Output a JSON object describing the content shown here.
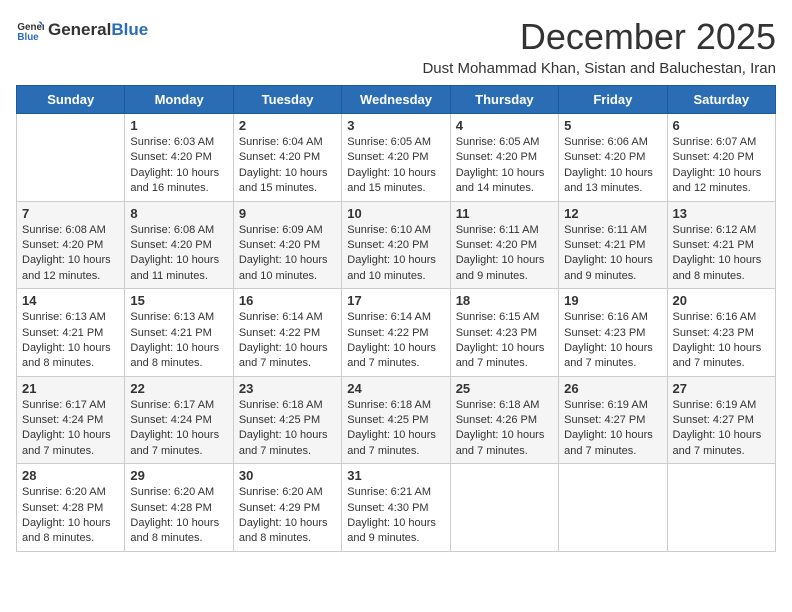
{
  "logo": {
    "general": "General",
    "blue": "Blue"
  },
  "title": "December 2025",
  "subtitle": "Dust Mohammad Khan, Sistan and Baluchestan, Iran",
  "weekdays": [
    "Sunday",
    "Monday",
    "Tuesday",
    "Wednesday",
    "Thursday",
    "Friday",
    "Saturday"
  ],
  "weeks": [
    [
      {
        "day": "",
        "content": ""
      },
      {
        "day": "1",
        "content": "Sunrise: 6:03 AM\nSunset: 4:20 PM\nDaylight: 10 hours\nand 16 minutes."
      },
      {
        "day": "2",
        "content": "Sunrise: 6:04 AM\nSunset: 4:20 PM\nDaylight: 10 hours\nand 15 minutes."
      },
      {
        "day": "3",
        "content": "Sunrise: 6:05 AM\nSunset: 4:20 PM\nDaylight: 10 hours\nand 15 minutes."
      },
      {
        "day": "4",
        "content": "Sunrise: 6:05 AM\nSunset: 4:20 PM\nDaylight: 10 hours\nand 14 minutes."
      },
      {
        "day": "5",
        "content": "Sunrise: 6:06 AM\nSunset: 4:20 PM\nDaylight: 10 hours\nand 13 minutes."
      },
      {
        "day": "6",
        "content": "Sunrise: 6:07 AM\nSunset: 4:20 PM\nDaylight: 10 hours\nand 12 minutes."
      }
    ],
    [
      {
        "day": "7",
        "content": "Sunrise: 6:08 AM\nSunset: 4:20 PM\nDaylight: 10 hours\nand 12 minutes."
      },
      {
        "day": "8",
        "content": "Sunrise: 6:08 AM\nSunset: 4:20 PM\nDaylight: 10 hours\nand 11 minutes."
      },
      {
        "day": "9",
        "content": "Sunrise: 6:09 AM\nSunset: 4:20 PM\nDaylight: 10 hours\nand 10 minutes."
      },
      {
        "day": "10",
        "content": "Sunrise: 6:10 AM\nSunset: 4:20 PM\nDaylight: 10 hours\nand 10 minutes."
      },
      {
        "day": "11",
        "content": "Sunrise: 6:11 AM\nSunset: 4:20 PM\nDaylight: 10 hours\nand 9 minutes."
      },
      {
        "day": "12",
        "content": "Sunrise: 6:11 AM\nSunset: 4:21 PM\nDaylight: 10 hours\nand 9 minutes."
      },
      {
        "day": "13",
        "content": "Sunrise: 6:12 AM\nSunset: 4:21 PM\nDaylight: 10 hours\nand 8 minutes."
      }
    ],
    [
      {
        "day": "14",
        "content": "Sunrise: 6:13 AM\nSunset: 4:21 PM\nDaylight: 10 hours\nand 8 minutes."
      },
      {
        "day": "15",
        "content": "Sunrise: 6:13 AM\nSunset: 4:21 PM\nDaylight: 10 hours\nand 8 minutes."
      },
      {
        "day": "16",
        "content": "Sunrise: 6:14 AM\nSunset: 4:22 PM\nDaylight: 10 hours\nand 7 minutes."
      },
      {
        "day": "17",
        "content": "Sunrise: 6:14 AM\nSunset: 4:22 PM\nDaylight: 10 hours\nand 7 minutes."
      },
      {
        "day": "18",
        "content": "Sunrise: 6:15 AM\nSunset: 4:23 PM\nDaylight: 10 hours\nand 7 minutes."
      },
      {
        "day": "19",
        "content": "Sunrise: 6:16 AM\nSunset: 4:23 PM\nDaylight: 10 hours\nand 7 minutes."
      },
      {
        "day": "20",
        "content": "Sunrise: 6:16 AM\nSunset: 4:23 PM\nDaylight: 10 hours\nand 7 minutes."
      }
    ],
    [
      {
        "day": "21",
        "content": "Sunrise: 6:17 AM\nSunset: 4:24 PM\nDaylight: 10 hours\nand 7 minutes."
      },
      {
        "day": "22",
        "content": "Sunrise: 6:17 AM\nSunset: 4:24 PM\nDaylight: 10 hours\nand 7 minutes."
      },
      {
        "day": "23",
        "content": "Sunrise: 6:18 AM\nSunset: 4:25 PM\nDaylight: 10 hours\nand 7 minutes."
      },
      {
        "day": "24",
        "content": "Sunrise: 6:18 AM\nSunset: 4:25 PM\nDaylight: 10 hours\nand 7 minutes."
      },
      {
        "day": "25",
        "content": "Sunrise: 6:18 AM\nSunset: 4:26 PM\nDaylight: 10 hours\nand 7 minutes."
      },
      {
        "day": "26",
        "content": "Sunrise: 6:19 AM\nSunset: 4:27 PM\nDaylight: 10 hours\nand 7 minutes."
      },
      {
        "day": "27",
        "content": "Sunrise: 6:19 AM\nSunset: 4:27 PM\nDaylight: 10 hours\nand 7 minutes."
      }
    ],
    [
      {
        "day": "28",
        "content": "Sunrise: 6:20 AM\nSunset: 4:28 PM\nDaylight: 10 hours\nand 8 minutes."
      },
      {
        "day": "29",
        "content": "Sunrise: 6:20 AM\nSunset: 4:28 PM\nDaylight: 10 hours\nand 8 minutes."
      },
      {
        "day": "30",
        "content": "Sunrise: 6:20 AM\nSunset: 4:29 PM\nDaylight: 10 hours\nand 8 minutes."
      },
      {
        "day": "31",
        "content": "Sunrise: 6:21 AM\nSunset: 4:30 PM\nDaylight: 10 hours\nand 9 minutes."
      },
      {
        "day": "",
        "content": ""
      },
      {
        "day": "",
        "content": ""
      },
      {
        "day": "",
        "content": ""
      }
    ]
  ]
}
